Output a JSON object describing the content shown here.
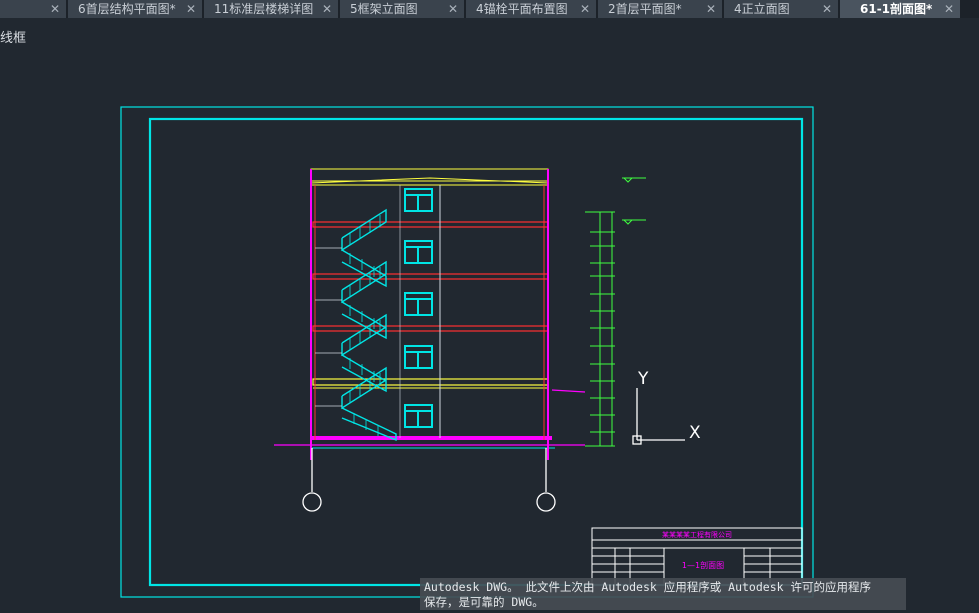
{
  "tabs": [
    {
      "label": "6首层结构平面图*",
      "close": "✕"
    },
    {
      "label": "11标准层楼梯详图",
      "close": "✕"
    },
    {
      "label": "5框架立面图",
      "close": "✕"
    },
    {
      "label": "4锚栓平面布置图",
      "close": "✕"
    },
    {
      "label": "2首层平面图*",
      "close": "✕"
    },
    {
      "label": "4正立面图",
      "close": "✕"
    },
    {
      "label": "61-1剖面图*",
      "close": "✕",
      "active": true
    }
  ],
  "viewport": {
    "label": "线框"
  },
  "ucs": {
    "y_label": "Y",
    "x_label": "X"
  },
  "title_block": {
    "row1": "某某某某工程有限公司",
    "drawing_name": "1—1剖面图"
  },
  "status_tip": {
    "line1": "Autodesk DWG。  此文件上次由 Autodesk 应用程序或 Autodesk 许可的应用程序",
    "line2": "保存，是可靠的 DWG。"
  },
  "colors": {
    "background": "#212830",
    "frame": "#00e5e5",
    "wall": "#ff00ff",
    "slab": "#ff3030",
    "roof": "#ffff40",
    "window": "#00e5e5",
    "dim": "#40ff40",
    "ucs": "#ffffff"
  }
}
